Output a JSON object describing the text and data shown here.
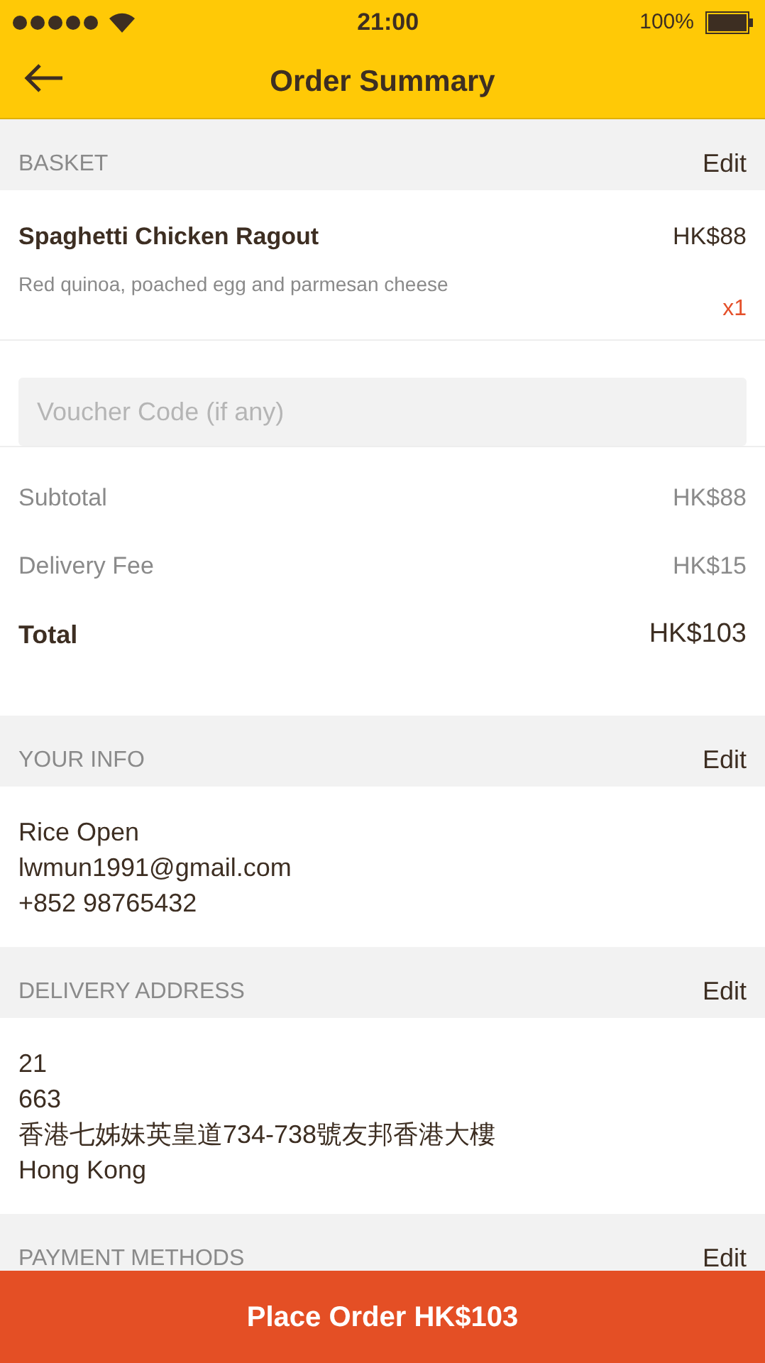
{
  "status_bar": {
    "time": "21:00",
    "battery": "100%"
  },
  "nav": {
    "title": "Order Summary"
  },
  "basket": {
    "header": "BASKET",
    "action": "Edit",
    "items": [
      {
        "name": "Spaghetti Chicken Ragout",
        "description": "Red quinoa, poached egg and parmesan cheese",
        "price": "HK$88",
        "quantity": "x1"
      }
    ]
  },
  "voucher": {
    "placeholder": "Voucher Code (if any)"
  },
  "summary": [
    {
      "kind": "line",
      "label": "Subtotal",
      "value": "HK$88"
    },
    {
      "kind": "line",
      "label": "Delivery Fee",
      "value": "HK$15"
    },
    {
      "kind": "total",
      "label": "Total",
      "value": "HK$103"
    }
  ],
  "sections": [
    {
      "header": "YOUR INFO",
      "action": "Edit",
      "lines": [
        "Rice Open",
        "lwmun1991@gmail.com",
        "+852 98765432"
      ]
    },
    {
      "header": "DELIVERY ADDRESS",
      "action": "Edit",
      "lines": [
        "21",
        "663",
        "香港七姊妹英皇道734-738號友邦香港大樓",
        "Hong Kong"
      ]
    },
    {
      "header": "PAYMENT METHODS",
      "action": "Edit"
    }
  ],
  "place_order": {
    "label": "Place Order **HK$103**"
  }
}
